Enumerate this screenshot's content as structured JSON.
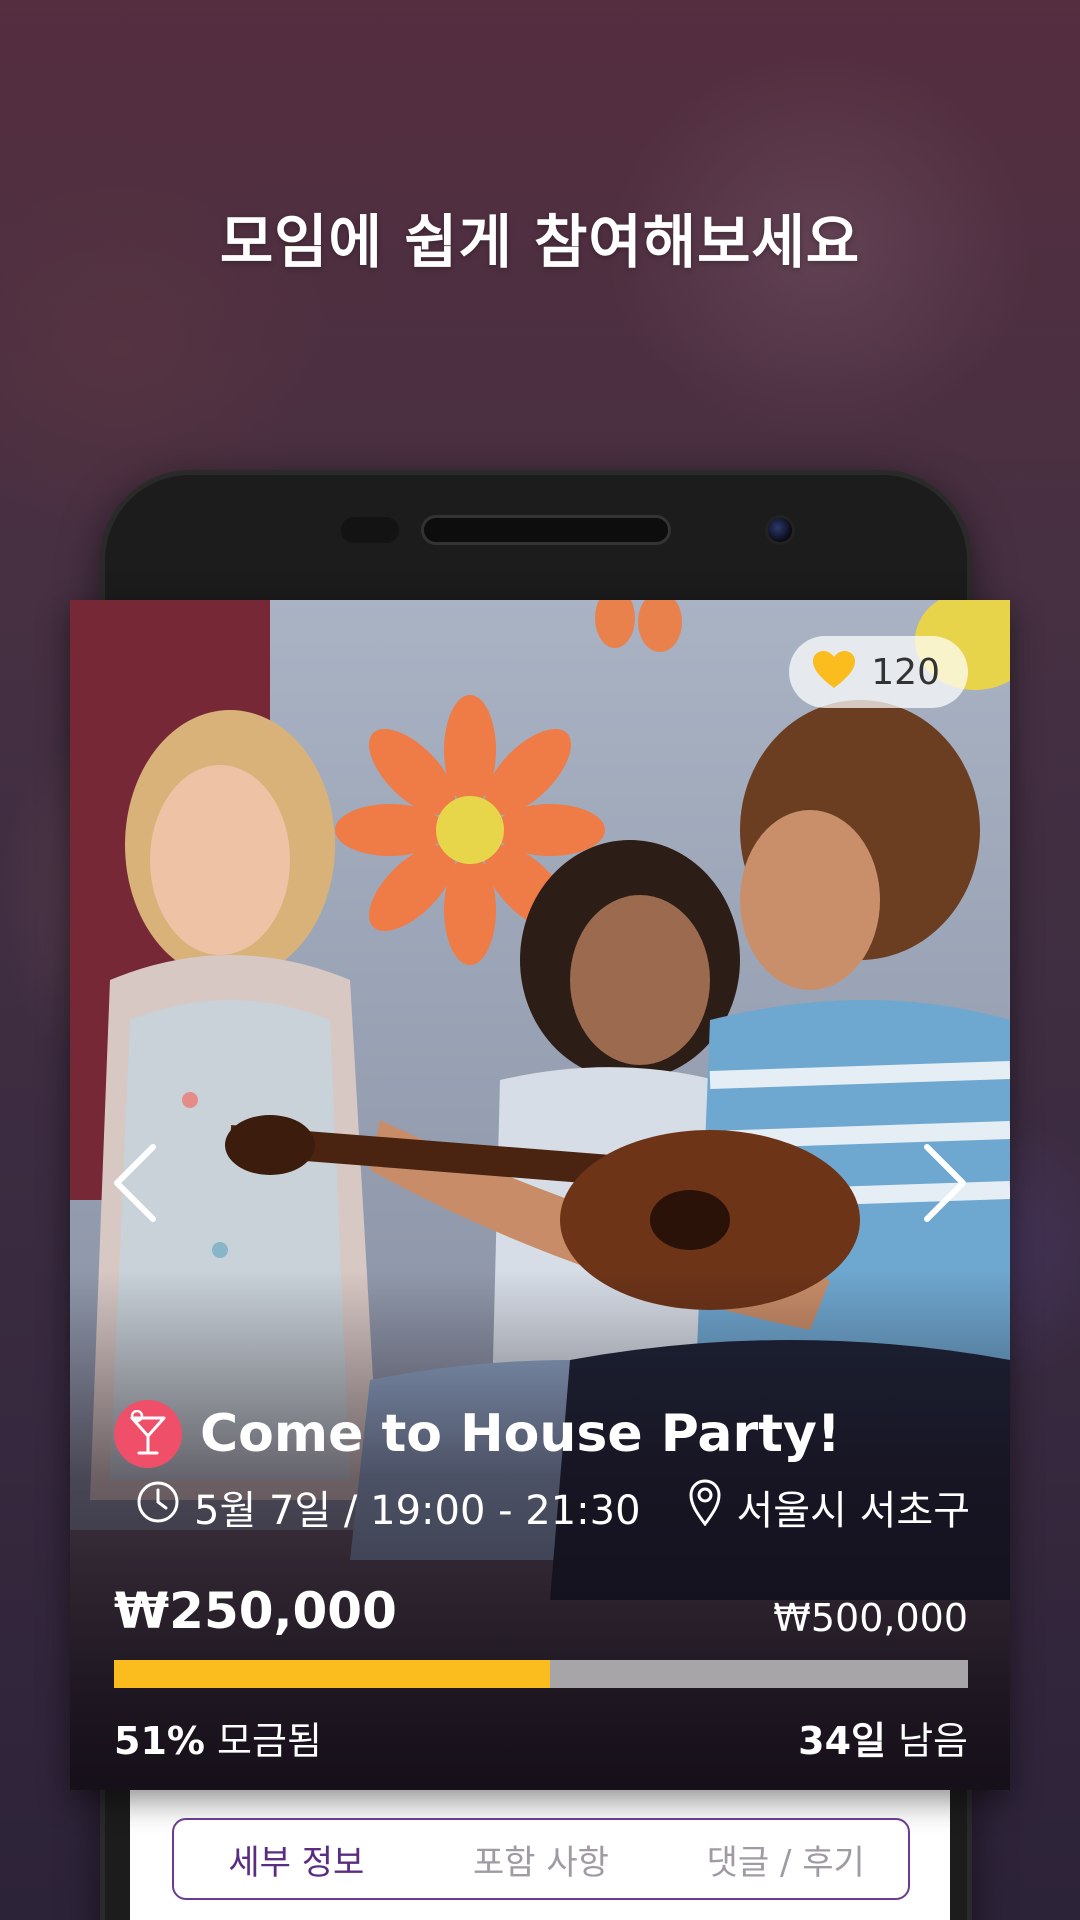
{
  "headline": "모임에 쉽게 참여해보세요",
  "event": {
    "like_count": "120",
    "title": "Come to House Party!",
    "datetime": "5월 7일 / 19:00 - 21:30",
    "location": "서울시 서초구",
    "raised": "₩250,000",
    "goal": "₩500,000",
    "progress_fraction": 0.51,
    "percent_value": "51%",
    "percent_suffix": " 모금됨",
    "days_value": "34일",
    "days_suffix": " 남음"
  },
  "tabs": [
    {
      "label": "세부 정보",
      "active": true
    },
    {
      "label": "포함 사항",
      "active": false
    },
    {
      "label": "댓글 / 후기",
      "active": false
    }
  ],
  "icons": {
    "heart": "heart-icon",
    "clock": "clock-icon",
    "pin": "location-pin-icon",
    "category": "cocktail-icon",
    "prev": "chevron-left-icon",
    "next": "chevron-right-icon"
  },
  "colors": {
    "progress_fill": "#fbbd1e",
    "progress_track": "#a7a5a8",
    "category_badge": "#ef4f68",
    "tab_active": "#5a2d82",
    "heart": "#fbbd1e"
  }
}
